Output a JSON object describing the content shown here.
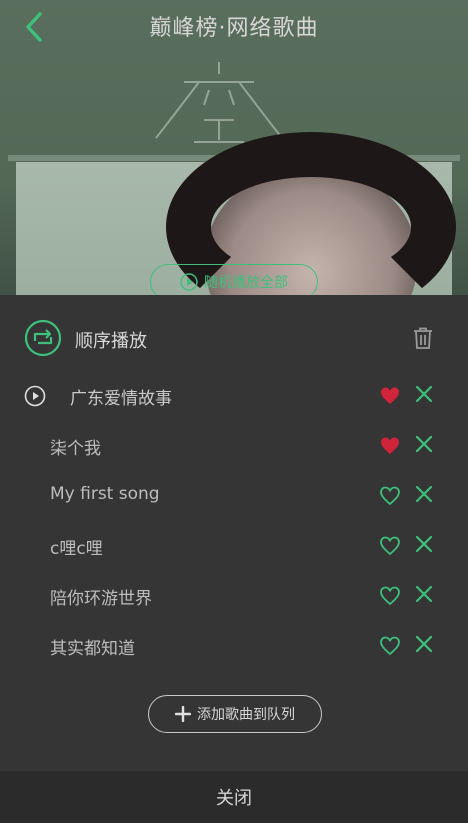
{
  "header": {
    "title": "巅峰榜·网络歌曲",
    "play_all_label": "随机播放全部"
  },
  "queue": {
    "mode_label": "顺序播放",
    "songs": [
      {
        "title": "广东爱情故事",
        "liked": true,
        "playing": true
      },
      {
        "title": "柒个我",
        "liked": true,
        "playing": false
      },
      {
        "title": "My first song",
        "liked": false,
        "playing": false
      },
      {
        "title": "c哩c哩",
        "liked": false,
        "playing": false
      },
      {
        "title": "陪你环游世界",
        "liked": false,
        "playing": false
      },
      {
        "title": "其实都知道",
        "liked": false,
        "playing": false
      }
    ],
    "add_label": "添加歌曲到队列",
    "close_label": "关闭"
  },
  "colors": {
    "accent": "#3ec07c",
    "liked": "#d0243a",
    "panel": "#353535"
  },
  "icons": [
    "back-arrow-icon",
    "play-circle-icon",
    "repeat-order-icon",
    "trash-icon",
    "heart-icon",
    "close-x-icon",
    "plus-icon"
  ]
}
